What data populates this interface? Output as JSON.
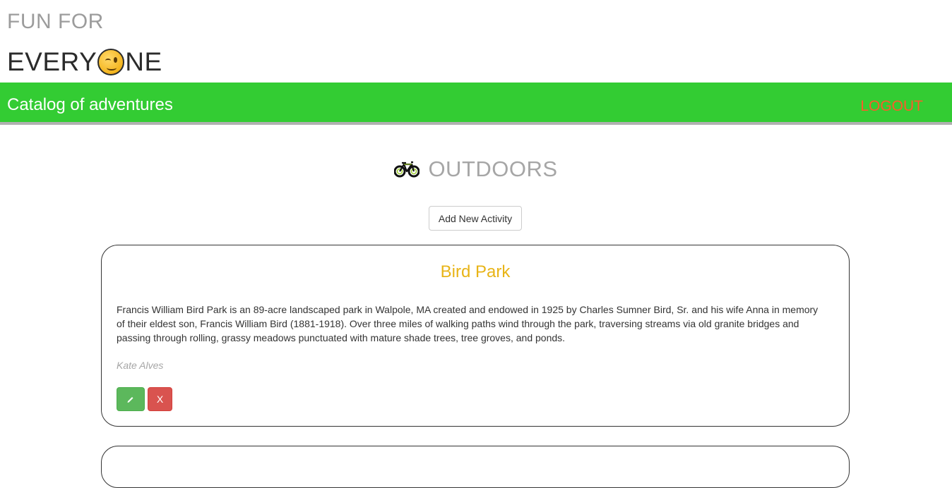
{
  "brand": {
    "line1": "FUN FOR",
    "line2_before": "EVERY",
    "line2_icon": "winking-face-emoji",
    "line2_after": "NE"
  },
  "navbar": {
    "title": "Catalog of adventures",
    "logout": "LOGOUT",
    "bg_color": "#33cc33",
    "logout_color": "#ff5a2a"
  },
  "section": {
    "icon": "bicycle-icon",
    "title": "OUTDOORS"
  },
  "actions": {
    "add_label": "Add New Activity"
  },
  "activities": [
    {
      "title": "Bird Park",
      "description": "Francis William Bird Park is an 89-acre landscaped park in Walpole, MA created and endowed in 1925 by Charles Sumner Bird, Sr. and his wife Anna in memory of their eldest son, Francis William Bird (1881-1918). Over three miles of walking paths wind through the park, traversing streams via old granite bridges and passing through rolling, grassy meadows punctuated with mature shade trees, tree groves, and ponds.",
      "author": "Kate Alves",
      "edit_icon": "pencil-icon",
      "delete_label": "X"
    }
  ]
}
